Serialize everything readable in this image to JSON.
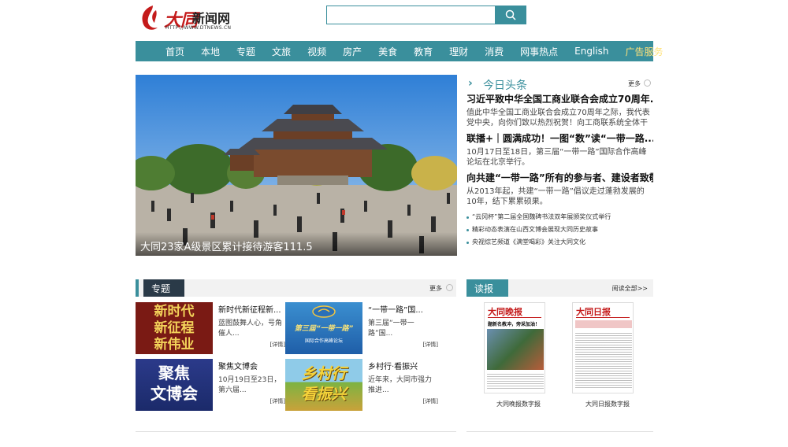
{
  "header": {
    "logo_brand": "大同",
    "logo_site": "新闻网",
    "logo_url": "HTTP://WWW.DTNEWS.CN",
    "search_placeholder": ""
  },
  "nav": {
    "items": [
      "首页",
      "本地",
      "专题",
      "文旅",
      "视频",
      "房产",
      "美食",
      "教育",
      "理财",
      "消费",
      "网事热点",
      "English",
      "广告服务"
    ]
  },
  "hero": {
    "caption": "大同23家A级景区累计接待游客111.5"
  },
  "today": {
    "title": "今日头条",
    "more": "更多",
    "news": [
      {
        "headline": "习近平致中华全国工商业联合会成立70周年...",
        "summary": "值此中华全国工商业联合会成立70周年之际，我代表党中央，向你们致以热烈祝贺！向工商联系统全体干部职工..."
      },
      {
        "headline": "联播+｜圆满成功！一图“数”读“一带一路...",
        "summary": "10月17日至18日，第三届“一带一路”国际合作高峰论坛在北京举行。"
      },
      {
        "headline": "向共建“一带一路”所有的参与者、建设者致敬",
        "summary": "从2013年起，共建“一带一路”倡议走过蓬勃发展的10年，结下累累硕果。"
      }
    ],
    "bullets": [
      "“云冈杯”第二届全国魏碑书法双年展颁奖仪式举行",
      "精彩动态表演在山西文博会展现大同历史故事",
      "央视综艺频道《满堂喝彩》关注大同文化"
    ]
  },
  "topics": {
    "title": "专题",
    "more": "更多",
    "cards": [
      {
        "title": "新时代新征程新...",
        "desc": "蓝图鼓舞人心，号角催人...",
        "detail": "[详情]",
        "thumb_text": [
          "新时代",
          "新征程",
          "新伟业"
        ]
      },
      {
        "title": "“一带一路”国...",
        "desc": "第三届“一带一路”国...",
        "detail": "[详情]",
        "thumb_text": [
          "第三届“一带一路”",
          "国际合作高峰论坛"
        ]
      },
      {
        "title": "聚焦文博会",
        "desc": "10月19日至23日，第六届...",
        "detail": "[详情]",
        "thumb_text": [
          "聚焦",
          "文博会"
        ]
      },
      {
        "title": "乡村行·看振兴",
        "desc": "近年来，大同市强力推进...",
        "detail": "[详情]",
        "thumb_text": [
          "乡村行",
          "看振兴"
        ]
      }
    ]
  },
  "reading": {
    "title": "读报",
    "more": "阅读全部>>",
    "papers": [
      {
        "masthead": "大同晚报",
        "caption": "大同晚报数字报",
        "headline": "题新名教冲，旁采加油！"
      },
      {
        "masthead": "大同日报",
        "caption": "大同日报数字报",
        "headline": ""
      }
    ]
  },
  "colors": {
    "accent": "#3a8f9c",
    "logo_red": "#c41a1a",
    "nav_ad": "#ffe27a"
  }
}
